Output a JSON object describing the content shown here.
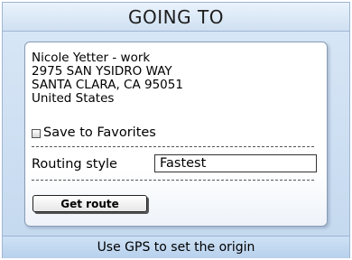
{
  "title": "GOING TO",
  "destination": {
    "name": "Nicole Yetter - work",
    "street": "2975 SAN YSIDRO WAY",
    "city_state_zip": "SANTA CLARA, CA 95051",
    "country": "United States"
  },
  "favorites": {
    "label": "Save to Favorites",
    "checked": false
  },
  "routing": {
    "label": "Routing style",
    "value": "Fastest"
  },
  "get_route_label": "Get route",
  "softkey": {
    "label": "Use GPS to set the origin"
  }
}
